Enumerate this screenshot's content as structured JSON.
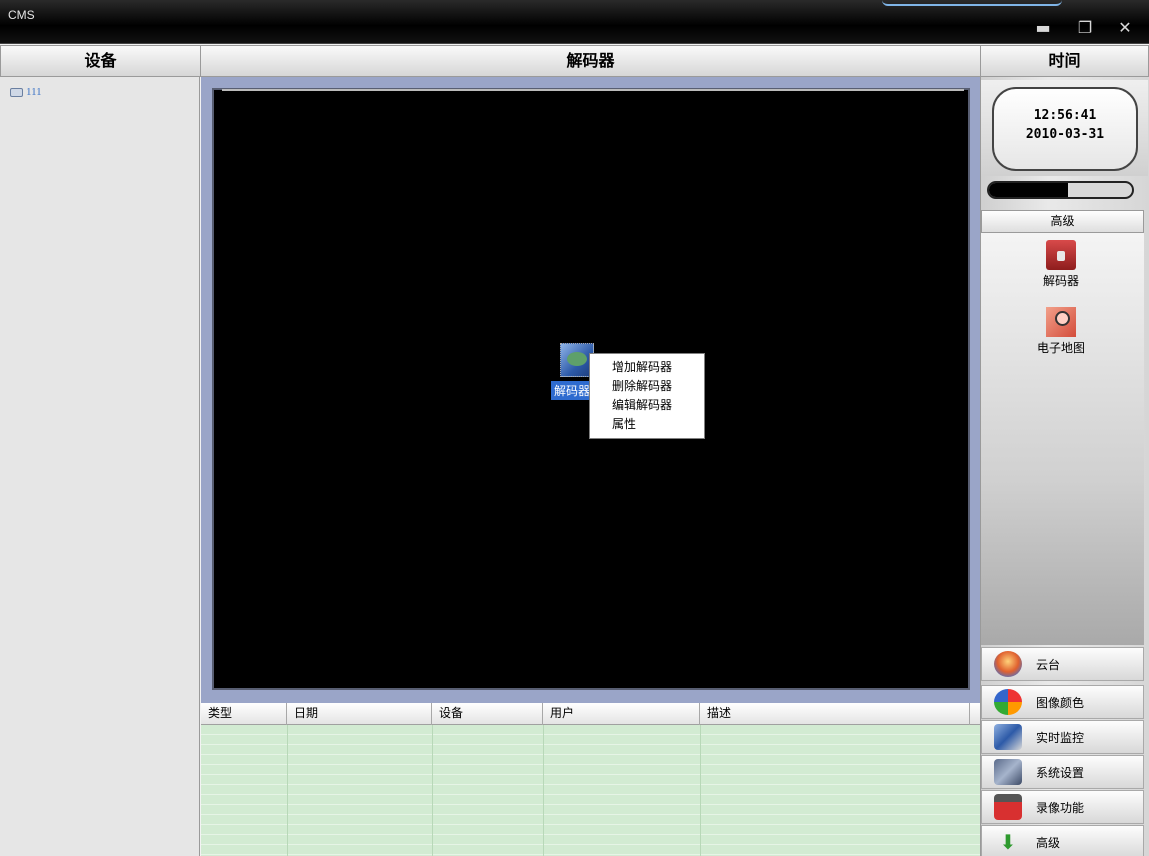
{
  "window": {
    "title": "CMS",
    "minimize_glyph": "▬",
    "restore_glyph": "❐",
    "close_glyph": "✕"
  },
  "headers": {
    "device": "设备",
    "decoder": "解码器",
    "time": "时间"
  },
  "device_tree": {
    "items": [
      {
        "label": "111",
        "icon": "camera-icon"
      }
    ]
  },
  "video": {
    "decoder_item_label": "解码器",
    "decoder_item_icon": "decoder-device-icon"
  },
  "context_menu": {
    "items": [
      "增加解码器",
      "删除解码器",
      "编辑解码器",
      "属性"
    ]
  },
  "log_table": {
    "columns": [
      "类型",
      "日期",
      "设备",
      "用户",
      "描述"
    ],
    "rows": []
  },
  "clock": {
    "time": "12:56:41",
    "date": "2010-03-31"
  },
  "progress": {
    "value_fraction": 0.55
  },
  "advanced_panel": {
    "title": "高级",
    "tools": [
      {
        "label": "解码器",
        "icon": "decoder-folder-icon"
      },
      {
        "label": "电子地图",
        "icon": "emap-icon"
      }
    ]
  },
  "nav": {
    "ptz": "云台",
    "image_color": "图像颜色",
    "live_monitor": "实时监控",
    "system_settings": "系统设置",
    "recording": "录像功能",
    "advanced": "高级"
  },
  "colors": {
    "titlebar": "#000000",
    "video_bg": "#000000",
    "video_border": "#9aa5c8",
    "log_bg": "#d2ebd2",
    "selection": "#2e6bcf",
    "tree_text": "#3b73c6"
  }
}
